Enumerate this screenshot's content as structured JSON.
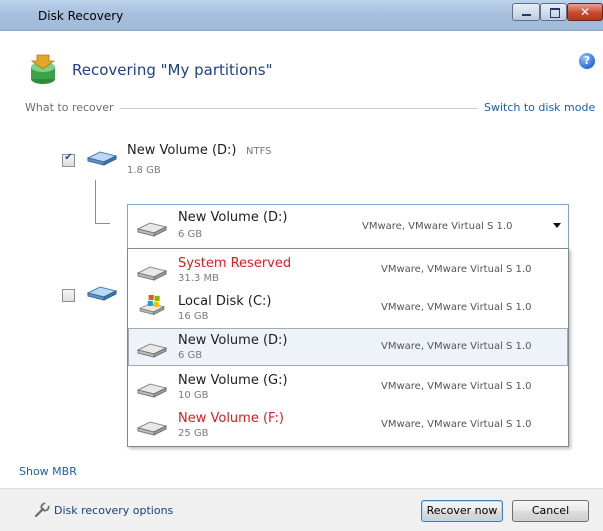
{
  "window": {
    "title": "Disk Recovery"
  },
  "header": {
    "title": "Recovering \"My partitions\""
  },
  "section": {
    "label": "What to recover",
    "switch_link": "Switch to disk mode"
  },
  "source_volume": {
    "name": "New Volume (D:)",
    "fs": "NTFS",
    "size": "1.8 GB",
    "checked": true
  },
  "second_row": {
    "checked": false
  },
  "target_combo": {
    "name": "New Volume (D:)",
    "size": "6 GB",
    "vendor": "VMware, VMware Virtual S 1.0"
  },
  "dropdown": {
    "items": [
      {
        "name": "System Reserved",
        "size": "31.3 MB",
        "vendor": "VMware, VMware Virtual S 1.0",
        "red": true,
        "icon": "disk-icon"
      },
      {
        "name": "Local Disk (C:)",
        "size": "16 GB",
        "vendor": "VMware, VMware Virtual S 1.0",
        "red": false,
        "icon": "windows-disk-icon"
      },
      {
        "name": "New Volume (D:)",
        "size": "6 GB",
        "vendor": "VMware, VMware Virtual S 1.0",
        "red": false,
        "selected": true,
        "icon": "disk-icon"
      },
      {
        "name": "New Volume (G:)",
        "size": "10 GB",
        "vendor": "VMware, VMware Virtual S 1.0",
        "red": false,
        "icon": "disk-icon"
      },
      {
        "name": "New Volume (F:)",
        "size": "25 GB",
        "vendor": "VMware, VMware Virtual S 1.0",
        "red": true,
        "icon": "disk-icon"
      }
    ]
  },
  "links": {
    "show_mbr": "Show MBR",
    "disk_recovery_options": "Disk recovery options"
  },
  "buttons": {
    "recover_now": "Recover now",
    "cancel": "Cancel"
  },
  "colors": {
    "link": "#1a5fb4",
    "title": "#1f3f8a",
    "warning_red": "#e21a1a"
  }
}
